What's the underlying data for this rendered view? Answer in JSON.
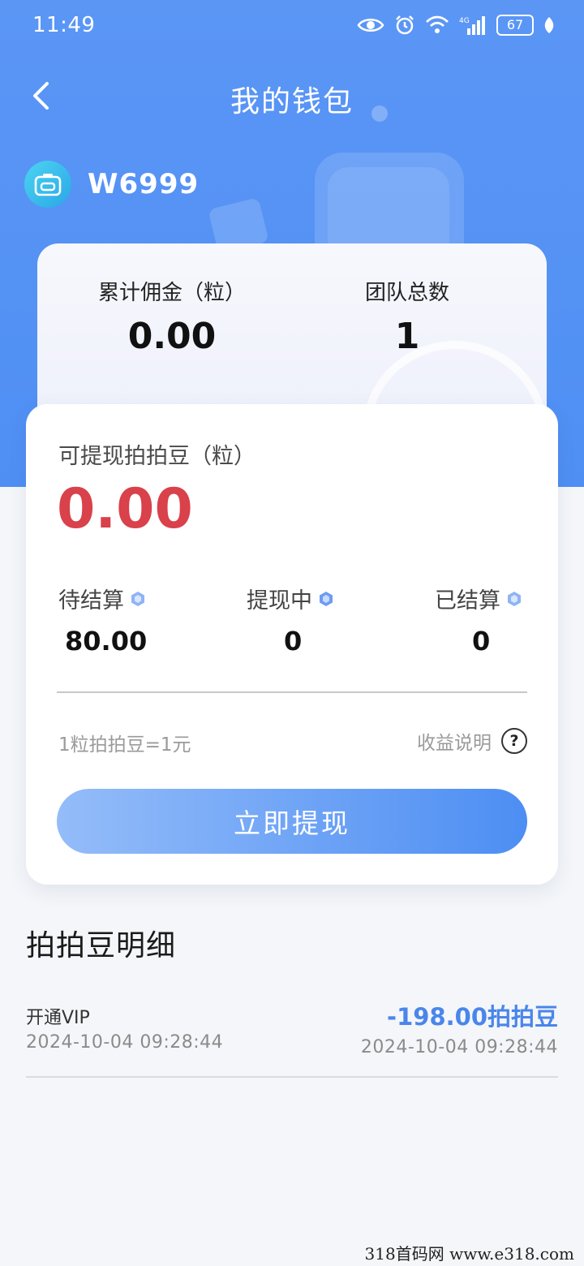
{
  "status_bar": {
    "time": "11:49",
    "network": "4G",
    "battery": "67"
  },
  "nav": {
    "title": "我的钱包"
  },
  "user": {
    "name": "W6999"
  },
  "stats": {
    "commission_label": "累计佣金（粒）",
    "commission_value": "0.00",
    "team_label": "团队总数",
    "team_value": "1"
  },
  "wallet": {
    "withdrawable_label": "可提现拍拍豆（粒）",
    "withdrawable_value": "0.00",
    "pending_label": "待结算",
    "pending_value": "80.00",
    "withdrawing_label": "提现中",
    "withdrawing_value": "0",
    "settled_label": "已结算",
    "settled_value": "0",
    "rate_text": "1粒拍拍豆=1元",
    "explain_text": "收益说明",
    "withdraw_button": "立即提现"
  },
  "details": {
    "title": "拍拍豆明细",
    "records": [
      {
        "title": "开通VIP",
        "date": "2024-10-04 09:28:44",
        "amount": "-198.00拍拍豆",
        "date_right": "2024-10-04 09:28:44"
      }
    ]
  },
  "watermark": "318首码网  www.e318.com",
  "colors": {
    "header_blue": "#5b96f5",
    "amount_red": "#d9414b",
    "record_blue": "#4a86ea"
  }
}
